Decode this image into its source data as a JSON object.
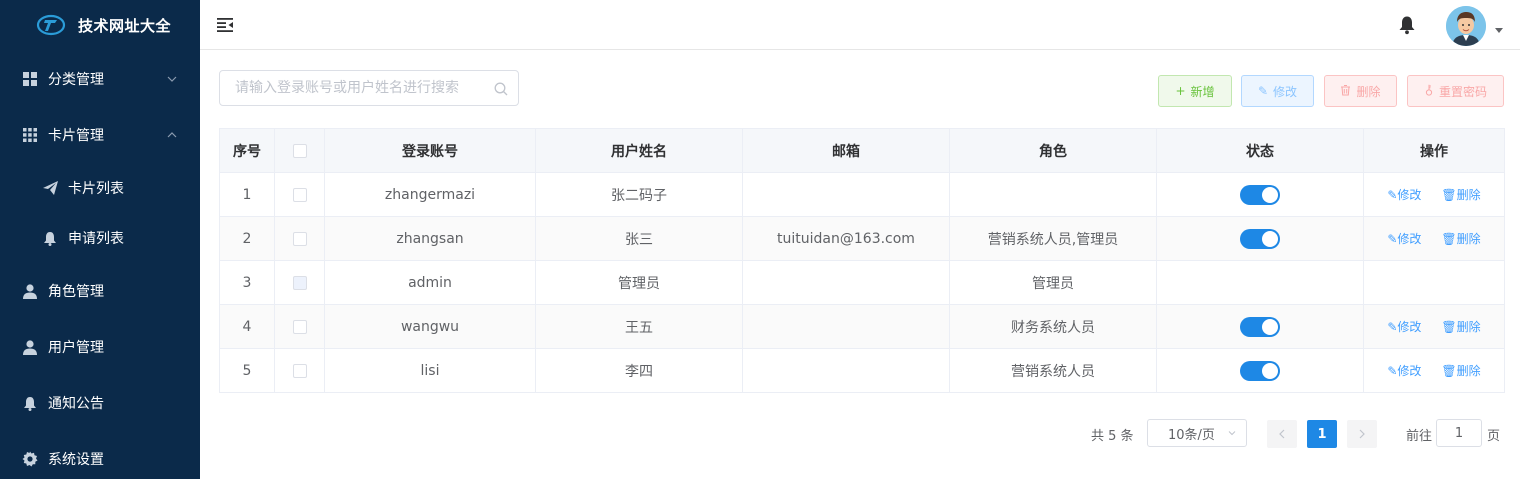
{
  "app": {
    "title": "技术网址大全"
  },
  "sidebar": {
    "items": [
      {
        "label": "分类管理",
        "icon": "grid-icon",
        "arrow": "down"
      },
      {
        "label": "卡片管理",
        "icon": "apps-icon",
        "arrow": "up"
      },
      {
        "label": "卡片列表",
        "icon": "paper-plane-icon"
      },
      {
        "label": "申请列表",
        "icon": "bell-icon"
      },
      {
        "label": "角色管理",
        "icon": "user-icon"
      },
      {
        "label": "用户管理",
        "icon": "user-icon"
      },
      {
        "label": "通知公告",
        "icon": "bell-icon"
      },
      {
        "label": "系统设置",
        "icon": "gear-icon"
      }
    ]
  },
  "search": {
    "placeholder": "请输入登录账号或用户姓名进行搜索",
    "value": ""
  },
  "toolbar": {
    "add": "新增",
    "edit": "修改",
    "delete": "删除",
    "reset_password": "重置密码"
  },
  "table": {
    "headers": [
      "序号",
      "",
      "登录账号",
      "用户姓名",
      "邮箱",
      "角色",
      "状态",
      "操作"
    ],
    "rows": [
      {
        "index": "1",
        "account": "zhangermazi",
        "name": "张二码子",
        "email": "",
        "role": "",
        "status": true,
        "ops": true
      },
      {
        "index": "2",
        "account": "zhangsan",
        "name": "张三",
        "email": "tuituidan@163.com",
        "role": "营销系统人员,管理员",
        "status": true,
        "ops": true
      },
      {
        "index": "3",
        "account": "admin",
        "name": "管理员",
        "email": "",
        "role": "管理员",
        "status": false,
        "ops": false
      },
      {
        "index": "4",
        "account": "wangwu",
        "name": "王五",
        "email": "",
        "role": "财务系统人员",
        "status": true,
        "ops": true
      },
      {
        "index": "5",
        "account": "lisi",
        "name": "李四",
        "email": "",
        "role": "营销系统人员",
        "status": true,
        "ops": true
      }
    ],
    "op_edit": "修改",
    "op_delete": "删除"
  },
  "pagination": {
    "total": "共 5 条",
    "page_size": "10条/页",
    "current": "1",
    "goto_label": "前往",
    "goto_value": "1",
    "page_suffix": "页"
  },
  "colors": {
    "sidebar": "#0b2a4a",
    "primary": "#1e88e5",
    "success": "#67c23a",
    "danger": "#f56c6c"
  }
}
